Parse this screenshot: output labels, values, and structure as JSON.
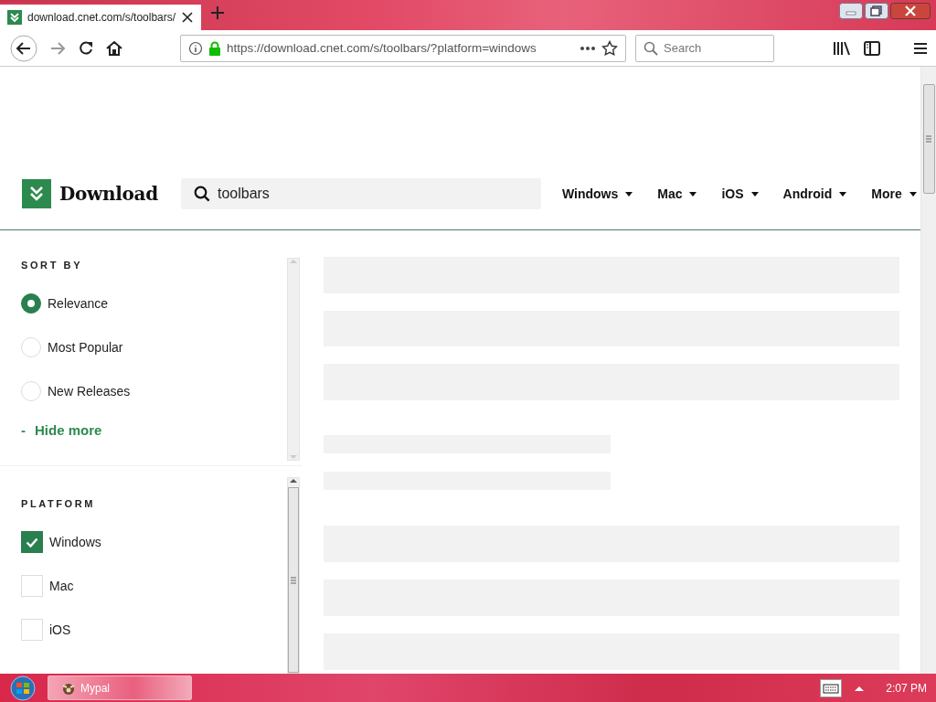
{
  "browser": {
    "tab": {
      "title": "download.cnet.com/s/toolbars/"
    },
    "address": "https://download.cnet.com/s/toolbars/?platform=windows",
    "search": {
      "placeholder": "Search"
    }
  },
  "site": {
    "logo": "Download",
    "search": {
      "value": "toolbars"
    },
    "nav": [
      {
        "label": "Windows"
      },
      {
        "label": "Mac"
      },
      {
        "label": "iOS"
      },
      {
        "label": "Android"
      },
      {
        "label": "More"
      }
    ]
  },
  "sort": {
    "title": "SORT BY",
    "options": [
      {
        "label": "Relevance",
        "selected": true
      },
      {
        "label": "Most Popular",
        "selected": false
      },
      {
        "label": "New Releases",
        "selected": false
      }
    ],
    "toggle": {
      "sign": "-",
      "label": "Hide more"
    }
  },
  "platform": {
    "title": "PLATFORM",
    "options": [
      {
        "label": "Windows",
        "checked": true
      },
      {
        "label": "Mac",
        "checked": false
      },
      {
        "label": "iOS",
        "checked": false
      }
    ]
  },
  "taskbar": {
    "items": [
      {
        "label": "Mypal"
      }
    ],
    "time": "2:07 PM"
  }
}
